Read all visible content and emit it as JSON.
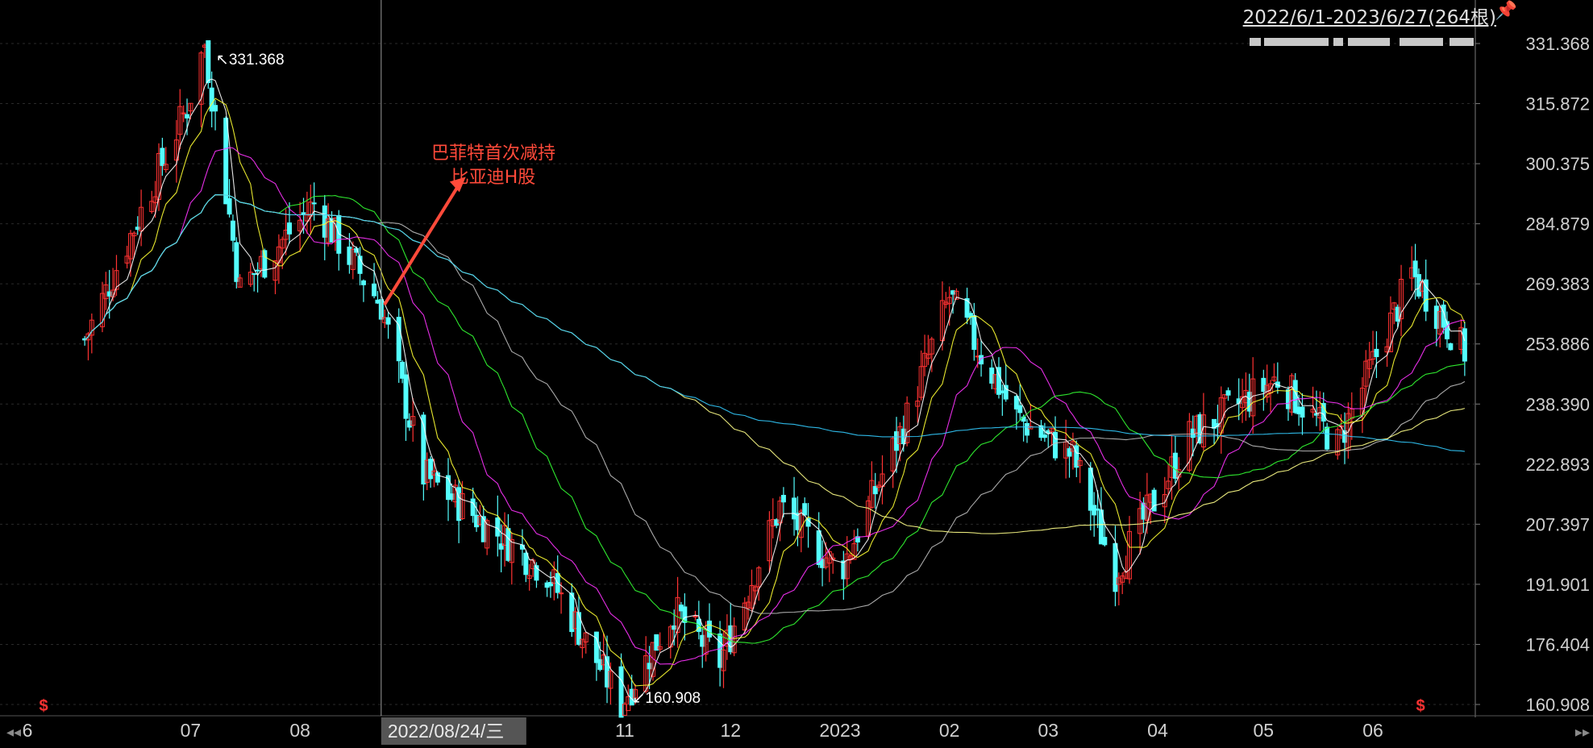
{
  "header": {
    "range_label": "2022/6/1-2023/6/27(264根)",
    "legend_strip": "▓▓▓▓▓▓▓ ▓▓ ▓▓▓ ▓▓▓▓▓ ▓▓▓"
  },
  "icons": {
    "pin": "pin-icon",
    "prev": "double-left-arrow-icon",
    "next": "double-right-arrow-icon",
    "dividend": "dividend-marker-icon"
  },
  "colors": {
    "background": "#000000",
    "up": "#ff3232",
    "down": "#54ffff",
    "annotation": "#ff4a3a",
    "ma_lines": [
      "#ffffff",
      "#ffff33",
      "#ff33ff",
      "#33ff33",
      "#bbbbbb",
      "#ffff88",
      "#33ccff"
    ]
  },
  "chart_data": {
    "type": "candlestick",
    "title": "",
    "ylim": [
      160.908,
      331.368
    ],
    "y_ticks": [
      331.368,
      315.872,
      300.375,
      284.879,
      269.383,
      253.886,
      238.39,
      222.893,
      207.397,
      191.901,
      176.404,
      160.908
    ],
    "y_tick_labels": [
      "331.368",
      "315.872",
      "300.375",
      "284.879",
      "269.383",
      "253.886",
      "238.390",
      "222.893",
      "207.397",
      "191.901",
      "176.404",
      "160.908"
    ],
    "x_tick_labels": [
      "06",
      "07",
      "08",
      "09",
      "10",
      "11",
      "12",
      "2023",
      "02",
      "03",
      "04",
      "05",
      "06"
    ],
    "first_tick_shown": "6",
    "crosshair_date": "2022/08/24/三",
    "max_marker": {
      "label": "↖331.368",
      "value": 331.368
    },
    "min_marker": {
      "label": "↙160.908",
      "value": 160.908
    },
    "annotation": {
      "line1": "巴菲特首次减持",
      "line2": "比亚迪H股"
    },
    "dividend_markers": [
      "$",
      "$"
    ],
    "key_prices": [
      {
        "date": "2022-06-01",
        "close": 255
      },
      {
        "date": "2022-06-30",
        "close": 315
      },
      {
        "date": "2022-07-05",
        "close": 331.368
      },
      {
        "date": "2022-07-15",
        "close": 268
      },
      {
        "date": "2022-08-05",
        "close": 290
      },
      {
        "date": "2022-08-24",
        "close": 264
      },
      {
        "date": "2022-09-05",
        "close": 220
      },
      {
        "date": "2022-10-10",
        "close": 195
      },
      {
        "date": "2022-10-31",
        "close": 160.908
      },
      {
        "date": "2022-11-15",
        "close": 185
      },
      {
        "date": "2022-11-28",
        "close": 172
      },
      {
        "date": "2022-12-15",
        "close": 212
      },
      {
        "date": "2023-01-01",
        "close": 195
      },
      {
        "date": "2023-01-20",
        "close": 235
      },
      {
        "date": "2023-02-01",
        "close": 266
      },
      {
        "date": "2023-02-20",
        "close": 235
      },
      {
        "date": "2023-03-08",
        "close": 225
      },
      {
        "date": "2023-03-20",
        "close": 195
      },
      {
        "date": "2023-04-10",
        "close": 230
      },
      {
        "date": "2023-05-05",
        "close": 245
      },
      {
        "date": "2023-05-22",
        "close": 228
      },
      {
        "date": "2023-06-12",
        "close": 272
      },
      {
        "date": "2023-06-27",
        "close": 252
      }
    ]
  }
}
